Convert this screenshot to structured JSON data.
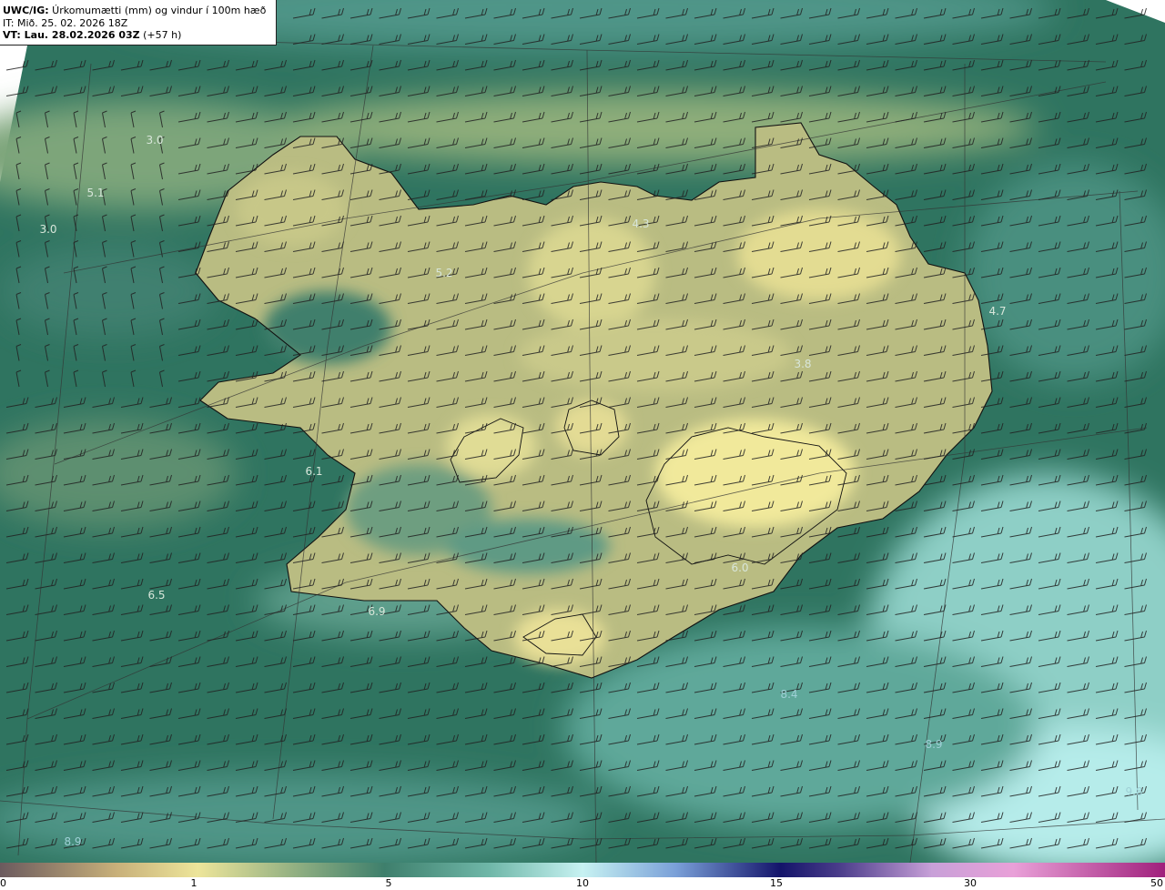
{
  "header": {
    "product_prefix": "UWC/IG:",
    "product_desc": " Úrkomumætti (mm) og vindur í 100m hæð",
    "init_time": "IT: Mið. 25. 02. 2026 18Z",
    "valid_prefix": "VT: Lau. 28.02.2026 03Z",
    "valid_suffix": " (+57 h)"
  },
  "map": {
    "field": "precipitable water (mm)",
    "overlay": "wind barbs at 100m",
    "region": "Iceland",
    "value_labels": [
      {
        "text": "3.0"
      },
      {
        "text": "5.1"
      },
      {
        "text": "3.0"
      },
      {
        "text": "5.2"
      },
      {
        "text": "4.3"
      },
      {
        "text": "4.7"
      },
      {
        "text": "3.8"
      },
      {
        "text": "6.1"
      },
      {
        "text": "6.0"
      },
      {
        "text": "6.5"
      },
      {
        "text": "6.9"
      },
      {
        "text": "8.4"
      },
      {
        "text": "8.9"
      },
      {
        "text": "9.8"
      },
      {
        "text": "8.9"
      }
    ]
  },
  "colorbar": {
    "ticks": [
      "0",
      "1",
      "5",
      "10",
      "15",
      "30",
      "50"
    ],
    "colors": {
      "zero": "#6b5a5e",
      "tan": "#c8b07a",
      "yellow": "#ede59a",
      "green": "#3e7f6c",
      "teal": "#6fb7a8",
      "cyan": "#c7f2f2",
      "navy": "#14146a",
      "pink": "#e9a0d8",
      "magenta": "#a0207c"
    }
  }
}
